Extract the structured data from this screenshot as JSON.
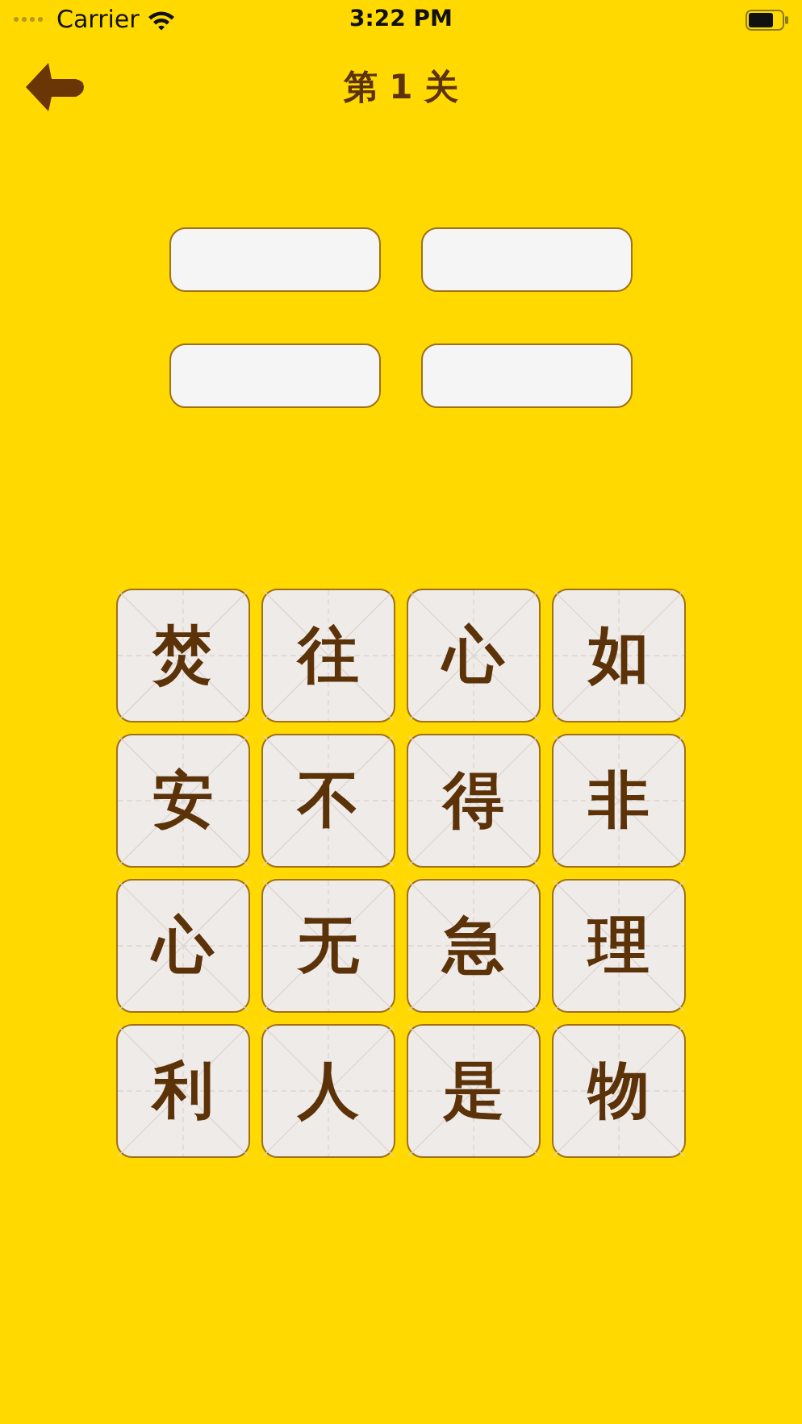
{
  "status_bar": {
    "carrier": "Carrier",
    "time": "3:22 PM"
  },
  "nav": {
    "title": "第 1 关"
  },
  "answer_slots": [
    {
      "filled": false
    },
    {
      "filled": false
    },
    {
      "filled": false
    },
    {
      "filled": false
    }
  ],
  "tiles": [
    {
      "char": "焚"
    },
    {
      "char": "往"
    },
    {
      "char": "心"
    },
    {
      "char": "如"
    },
    {
      "char": "安"
    },
    {
      "char": "不"
    },
    {
      "char": "得"
    },
    {
      "char": "非"
    },
    {
      "char": "心"
    },
    {
      "char": "无"
    },
    {
      "char": "急"
    },
    {
      "char": "理"
    },
    {
      "char": "利"
    },
    {
      "char": "人"
    },
    {
      "char": "是"
    },
    {
      "char": "物"
    }
  ]
}
